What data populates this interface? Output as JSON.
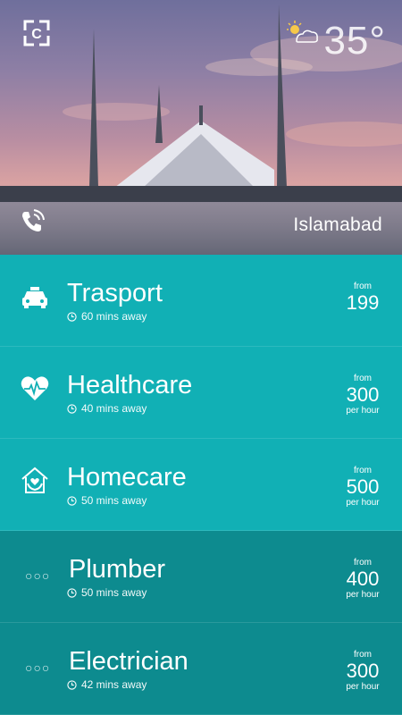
{
  "header": {
    "logo_letter": "C",
    "temperature": "35°",
    "city": "Islamabad",
    "icons": {
      "logo": "brand-logo-icon",
      "weather": "partly-cloudy-icon",
      "call": "phone-call-icon"
    }
  },
  "services": [
    {
      "name": "Trasport",
      "eta": "60 mins away",
      "from_label": "from",
      "price": "199",
      "unit": "",
      "icon": "taxi-icon",
      "tone": "teal"
    },
    {
      "name": "Healthcare",
      "eta": "40 mins away",
      "from_label": "from",
      "price": "300",
      "unit": "per hour",
      "icon": "heart-pulse-icon",
      "tone": "teal"
    },
    {
      "name": "Homecare",
      "eta": "50 mins away",
      "from_label": "from",
      "price": "500",
      "unit": "per hour",
      "icon": "home-care-icon",
      "tone": "teal"
    },
    {
      "name": "Plumber",
      "eta": "50 mins away",
      "from_label": "from",
      "price": "400",
      "unit": "per hour",
      "icon": "more-dots-icon",
      "tone": "dark"
    },
    {
      "name": "Electrician",
      "eta": "42 mins away",
      "from_label": "from",
      "price": "300",
      "unit": "per hour",
      "icon": "more-dots-icon",
      "tone": "dark"
    }
  ],
  "colors": {
    "teal": "#11b0b5",
    "dark_teal": "#0d8b8f"
  }
}
